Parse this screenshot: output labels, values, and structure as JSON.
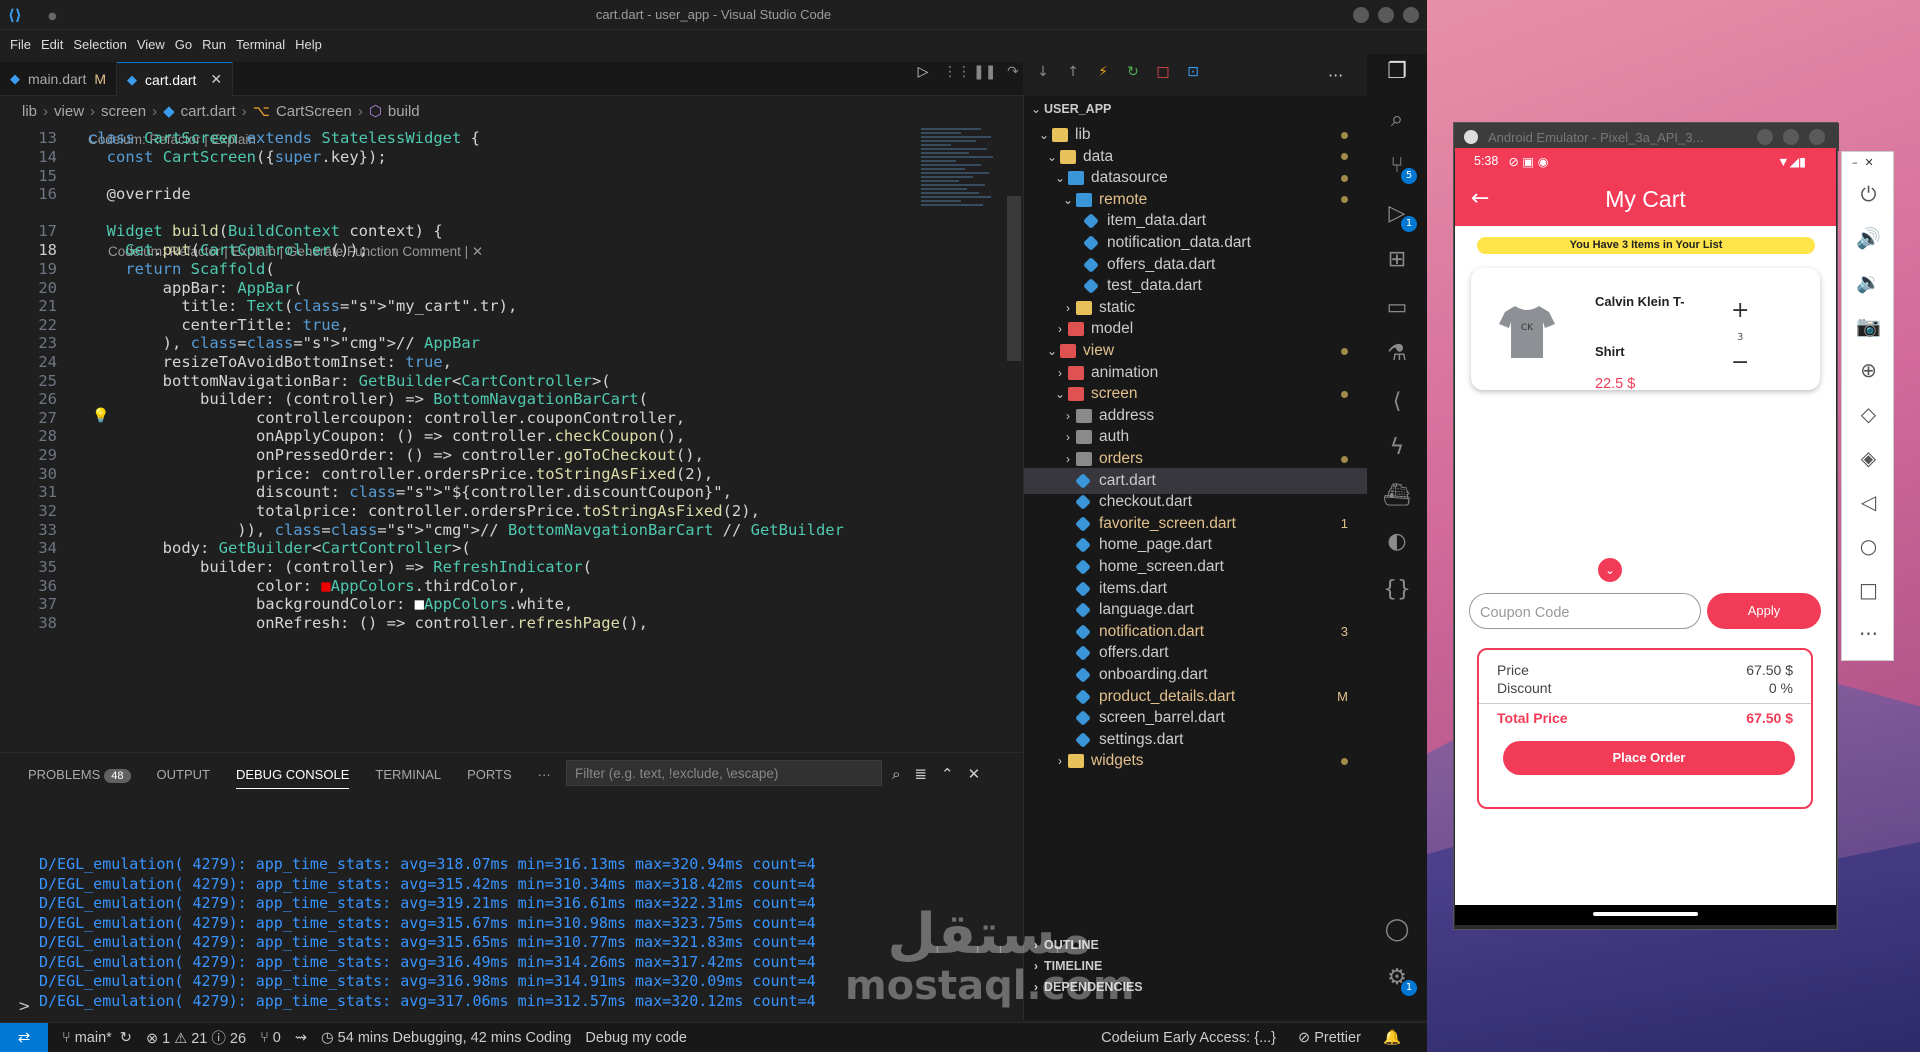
{
  "window": {
    "title": "cart.dart - user_app - Visual Studio Code"
  },
  "menu": [
    "File",
    "Edit",
    "Selection",
    "View",
    "Go",
    "Run",
    "Terminal",
    "Help"
  ],
  "tabs": [
    {
      "label": "main.dart",
      "badge": "M"
    },
    {
      "label": "cart.dart",
      "close": "✕"
    }
  ],
  "breadcrumb": [
    "lib",
    "view",
    "screen",
    "cart.dart",
    "CartScreen",
    "build"
  ],
  "editor": {
    "codelens1": "Codeium: Refactor | Explain",
    "codelens2": "Codeium: Refactor | Explain | Generate Function Comment | ✕",
    "lines": [
      {
        "n": "13",
        "t": "class CartScreen extends StatelessWidget {"
      },
      {
        "n": "14",
        "t": "  const CartScreen({super.key});"
      },
      {
        "n": "15",
        "t": ""
      },
      {
        "n": "16",
        "t": "  @override"
      },
      {
        "n": "17",
        "t": "  Widget build(BuildContext context) {"
      },
      {
        "n": "18",
        "t": "    Get.put(CartController());"
      },
      {
        "n": "19",
        "t": "    return Scaffold("
      },
      {
        "n": "20",
        "t": "        appBar: AppBar("
      },
      {
        "n": "21",
        "t": "          title: Text(\"my_cart\".tr),"
      },
      {
        "n": "22",
        "t": "          centerTitle: true,"
      },
      {
        "n": "23",
        "t": "        ), // AppBar"
      },
      {
        "n": "24",
        "t": "        resizeToAvoidBottomInset: true,"
      },
      {
        "n": "25",
        "t": "        bottomNavigationBar: GetBuilder<CartController>("
      },
      {
        "n": "26",
        "t": "            builder: (controller) => BottomNavgationBarCart("
      },
      {
        "n": "27",
        "t": "                  controllercoupon: controller.couponController,"
      },
      {
        "n": "28",
        "t": "                  onApplyCoupon: () => controller.checkCoupon(),"
      },
      {
        "n": "29",
        "t": "                  onPressedOrder: () => controller.goToCheckout(),"
      },
      {
        "n": "30",
        "t": "                  price: controller.ordersPrice.toStringAsFixed(2),"
      },
      {
        "n": "31",
        "t": "                  discount: \"${controller.discountCoupon}\","
      },
      {
        "n": "32",
        "t": "                  totalprice: controller.ordersPrice.toStringAsFixed(2),"
      },
      {
        "n": "33",
        "t": "                )), // BottomNavgationBarCart // GetBuilder"
      },
      {
        "n": "34",
        "t": "        body: GetBuilder<CartController>("
      },
      {
        "n": "35",
        "t": "            builder: (controller) => RefreshIndicator("
      },
      {
        "n": "36",
        "t": "                  color: ■AppColors.thirdColor,"
      },
      {
        "n": "37",
        "t": "                  backgroundColor: □AppColors.white,"
      },
      {
        "n": "38",
        "t": "                  onRefresh: () => controller.refreshPage(),"
      }
    ]
  },
  "panel": {
    "tabs": [
      {
        "label": "PROBLEMS",
        "badge": "48"
      },
      {
        "label": "OUTPUT"
      },
      {
        "label": "DEBUG CONSOLE"
      },
      {
        "label": "TERMINAL"
      },
      {
        "label": "PORTS"
      }
    ],
    "more": "···",
    "filter_placeholder": "Filter (e.g. text, !exclude, \\escape)",
    "log": [
      "D/EGL_emulation( 4279): app_time_stats: avg=318.07ms min=316.13ms max=320.94ms count=4",
      "D/EGL_emulation( 4279): app_time_stats: avg=315.42ms min=310.34ms max=318.42ms count=4",
      "D/EGL_emulation( 4279): app_time_stats: avg=319.21ms min=316.61ms max=322.31ms count=4",
      "D/EGL_emulation( 4279): app_time_stats: avg=315.67ms min=310.98ms max=323.75ms count=4",
      "D/EGL_emulation( 4279): app_time_stats: avg=315.65ms min=310.77ms max=321.83ms count=4",
      "D/EGL_emulation( 4279): app_time_stats: avg=316.49ms min=314.26ms max=317.42ms count=4",
      "D/EGL_emulation( 4279): app_time_stats: avg=316.98ms min=314.91ms max=320.09ms count=4",
      "D/EGL_emulation( 4279): app_time_stats: avg=317.06ms min=312.57ms max=320.12ms count=4"
    ],
    "prompt": ">"
  },
  "explorer": {
    "root": "USER_APP",
    "items": [
      {
        "label": "lib",
        "type": "folder",
        "color": "yellow",
        "depth": 1,
        "open": true,
        "dot": true
      },
      {
        "label": "data",
        "type": "folder",
        "color": "yellow",
        "depth": 2,
        "open": true,
        "dot": true
      },
      {
        "label": "datasource",
        "type": "folder",
        "color": "blue",
        "depth": 3,
        "open": true,
        "dot": true
      },
      {
        "label": "remote",
        "type": "folder",
        "color": "blue",
        "depth": 4,
        "open": true,
        "dot": true,
        "mod": true
      },
      {
        "label": "item_data.dart",
        "type": "dart",
        "depth": 5
      },
      {
        "label": "notification_data.dart",
        "type": "dart",
        "depth": 5
      },
      {
        "label": "offers_data.dart",
        "type": "dart",
        "depth": 5
      },
      {
        "label": "test_data.dart",
        "type": "dart",
        "depth": 5
      },
      {
        "label": "static",
        "type": "folder",
        "color": "yellow",
        "depth": 4,
        "open": false
      },
      {
        "label": "model",
        "type": "folder",
        "color": "red",
        "depth": 3,
        "open": false
      },
      {
        "label": "view",
        "type": "folder",
        "color": "red",
        "depth": 2,
        "open": true,
        "dot": true,
        "mod": true
      },
      {
        "label": "animation",
        "type": "folder",
        "color": "red",
        "depth": 3,
        "open": false
      },
      {
        "label": "screen",
        "type": "folder",
        "color": "red",
        "depth": 3,
        "open": true,
        "dot": true,
        "mod": true
      },
      {
        "label": "address",
        "type": "folder",
        "color": "grey",
        "depth": 4,
        "open": false
      },
      {
        "label": "auth",
        "type": "folder",
        "color": "grey",
        "depth": 4,
        "open": false
      },
      {
        "label": "orders",
        "type": "folder",
        "color": "grey",
        "depth": 4,
        "open": false,
        "dot": true,
        "mod": true
      },
      {
        "label": "cart.dart",
        "type": "dart",
        "depth": 4,
        "selected": true
      },
      {
        "label": "checkout.dart",
        "type": "dart",
        "depth": 4
      },
      {
        "label": "favorite_screen.dart",
        "type": "dart",
        "depth": 4,
        "num": "1",
        "mod": true
      },
      {
        "label": "home_page.dart",
        "type": "dart",
        "depth": 4
      },
      {
        "label": "home_screen.dart",
        "type": "dart",
        "depth": 4
      },
      {
        "label": "items.dart",
        "type": "dart",
        "depth": 4
      },
      {
        "label": "language.dart",
        "type": "dart",
        "depth": 4
      },
      {
        "label": "notification.dart",
        "type": "dart",
        "depth": 4,
        "num": "3",
        "mod": true
      },
      {
        "label": "offers.dart",
        "type": "dart",
        "depth": 4
      },
      {
        "label": "onboarding.dart",
        "type": "dart",
        "depth": 4
      },
      {
        "label": "product_details.dart",
        "type": "dart",
        "depth": 4,
        "num": "M",
        "mod": true
      },
      {
        "label": "screen_barrel.dart",
        "type": "dart",
        "depth": 4
      },
      {
        "label": "settings.dart",
        "type": "dart",
        "depth": 4
      },
      {
        "label": "widgets",
        "type": "folder",
        "color": "yellow",
        "depth": 3,
        "open": false,
        "dot": true,
        "mod": true
      }
    ],
    "sections": [
      "OUTLINE",
      "TIMELINE",
      "DEPENDENCIES"
    ]
  },
  "activity_badges": {
    "scm": "5",
    "debug": "1",
    "settings": "1"
  },
  "status": {
    "branch": "main*",
    "problems": "⊗ 1  ⚠ 21  ⓘ 26",
    "ports": "⑂ 0",
    "time": "54 mins Debugging, 42 mins Coding",
    "debug": "Debug my code",
    "codeium": "Codeium Early Access: {...}",
    "prettier": "Prettier"
  },
  "watermark": {
    "arabic": "مستقل",
    "latin": "mostaql.com"
  },
  "emulator": {
    "title": "Android Emulator - Pixel_3a_API_3...",
    "time": "5:38",
    "app_title": "My Cart",
    "notice": "You Have 3 Items in Your List",
    "product": {
      "name_line1": "Calvin Klein T-",
      "name_line2": "Shirt",
      "price": "22.5 $",
      "qty": "3"
    },
    "coupon_placeholder": "Coupon Code",
    "apply": "Apply",
    "summary": {
      "price_label": "Price",
      "price": "67.50 $",
      "discount_label": "Discount",
      "discount": "0 %",
      "total_label": "Total Price",
      "total": "67.50 $"
    },
    "place_order": "Place Order"
  },
  "colors": {
    "accent": "#f23b57",
    "vscode_blue": "#0078d4",
    "notice_yellow": "#ffe44a"
  }
}
